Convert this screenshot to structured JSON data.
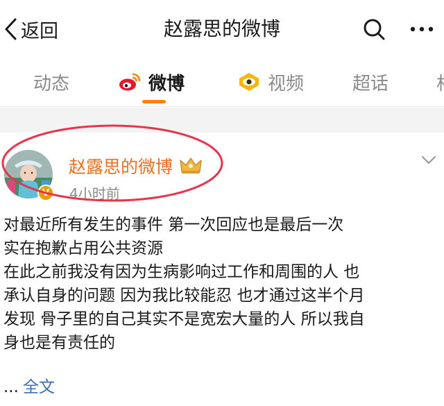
{
  "nav": {
    "back_label": "返回",
    "title": "赵露思的微博"
  },
  "tabs": [
    {
      "label": "动态",
      "icon": null,
      "active": false
    },
    {
      "label": "微博",
      "icon": "weibo-logo-icon",
      "active": true
    },
    {
      "label": "视频",
      "icon": "video-eye-icon",
      "active": false
    },
    {
      "label": "超话",
      "icon": null,
      "active": false
    },
    {
      "label": "相",
      "icon": null,
      "active": false
    }
  ],
  "post": {
    "author": "赵露思的微博",
    "time": "4小时前",
    "lines": [
      "对最近所有发生的事件 第一次回应也是最后一次",
      "实在抱歉占用公共资源",
      "在此之前我没有因为生病影响过工作和周围的人 也",
      "承认自身的问题 因为我比较能忍 也才通过这半个月",
      "发现 骨子里的自己其实不是宽宏大量的人 所以我自",
      "身也是有责任的"
    ],
    "ellipsis": "...",
    "full_text_label": "全文",
    "verified_badge": "V"
  },
  "colors": {
    "accent_orange": "#ff8200",
    "author_name": "#ee6d1f",
    "link_blue": "#3a6fb0",
    "annotation_red": "#e8334a",
    "badge_gold": "#e89d00"
  }
}
